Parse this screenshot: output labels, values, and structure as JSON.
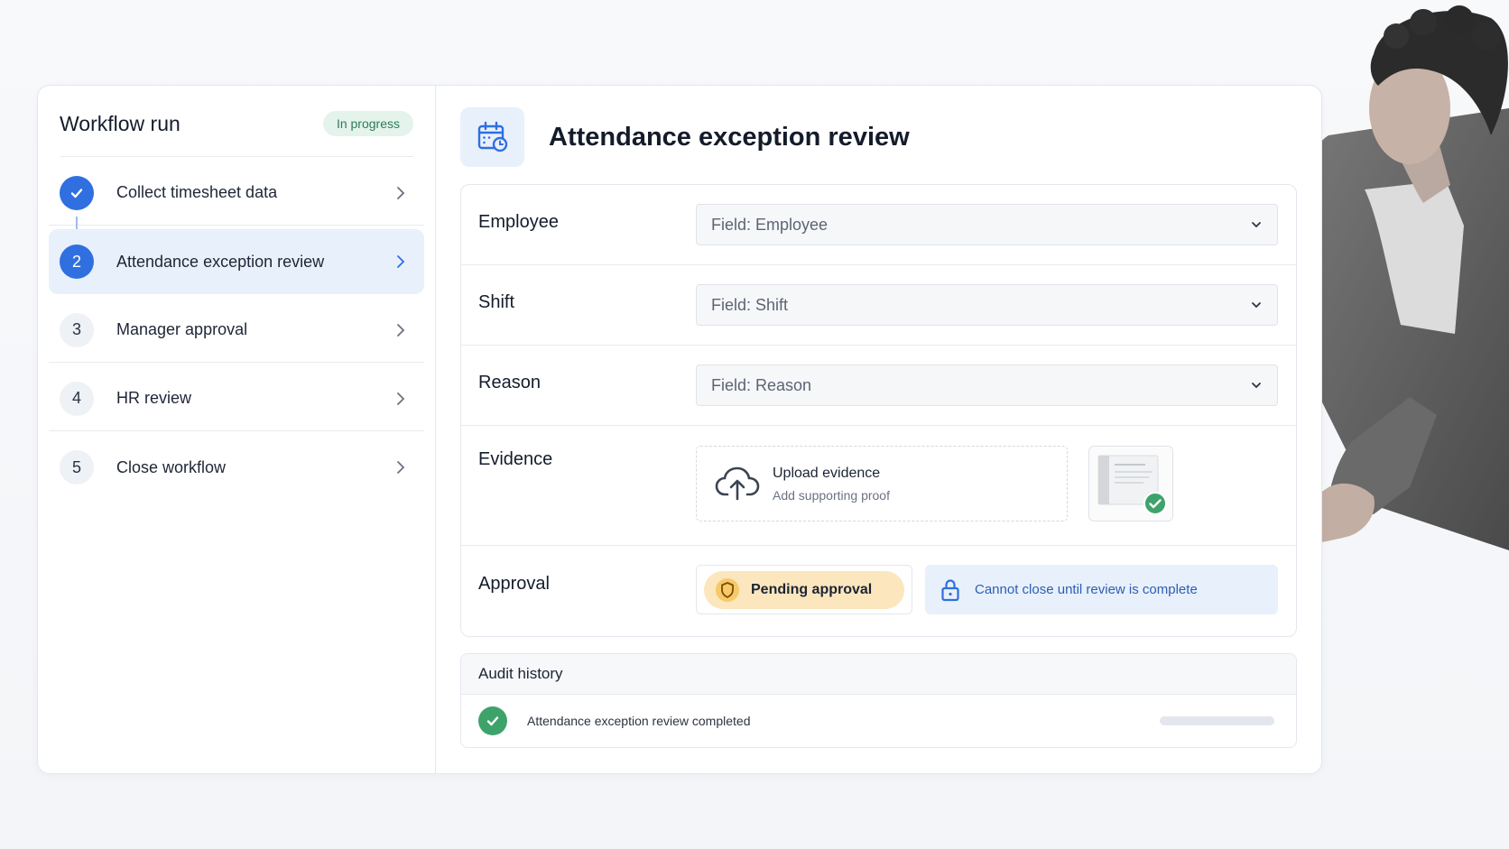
{
  "sidebar": {
    "title": "Workflow run",
    "status_badge": "In progress",
    "steps": [
      {
        "number": "",
        "label": "Collect timesheet data",
        "state": "done"
      },
      {
        "number": "2",
        "label": "Attendance exception review",
        "state": "active"
      },
      {
        "number": "3",
        "label": "Manager approval",
        "state": "pending"
      },
      {
        "number": "4",
        "label": "HR review",
        "state": "pending"
      },
      {
        "number": "5",
        "label": "Close workflow",
        "state": "pending"
      }
    ]
  },
  "main": {
    "title": "Attendance exception review",
    "header_icon": "calendar-clock-icon",
    "fields": {
      "employee": {
        "label": "Employee",
        "placeholder": "Field: Employee"
      },
      "shift": {
        "label": "Shift",
        "placeholder": "Field: Shift"
      },
      "reason": {
        "label": "Reason",
        "placeholder": "Field: Reason"
      }
    },
    "evidence": {
      "label": "Evidence",
      "upload_title": "Upload evidence",
      "upload_subtitle": "Add supporting proof",
      "upload_icon": "cloud-upload-icon",
      "thumbnail_status": "verified"
    },
    "approval": {
      "label": "Approval",
      "status": "Pending approval",
      "lock_message": "Cannot close until review is complete"
    }
  },
  "audit": {
    "title": "Audit history",
    "entries": [
      {
        "text": "Attendance exception review completed",
        "status": "success"
      }
    ]
  },
  "colors": {
    "accent": "#2f6fe0",
    "success": "#3ea36b",
    "pending": "#fce6bd",
    "badge_bg": "#e4f3ec",
    "badge_text": "#2f7a5a"
  }
}
